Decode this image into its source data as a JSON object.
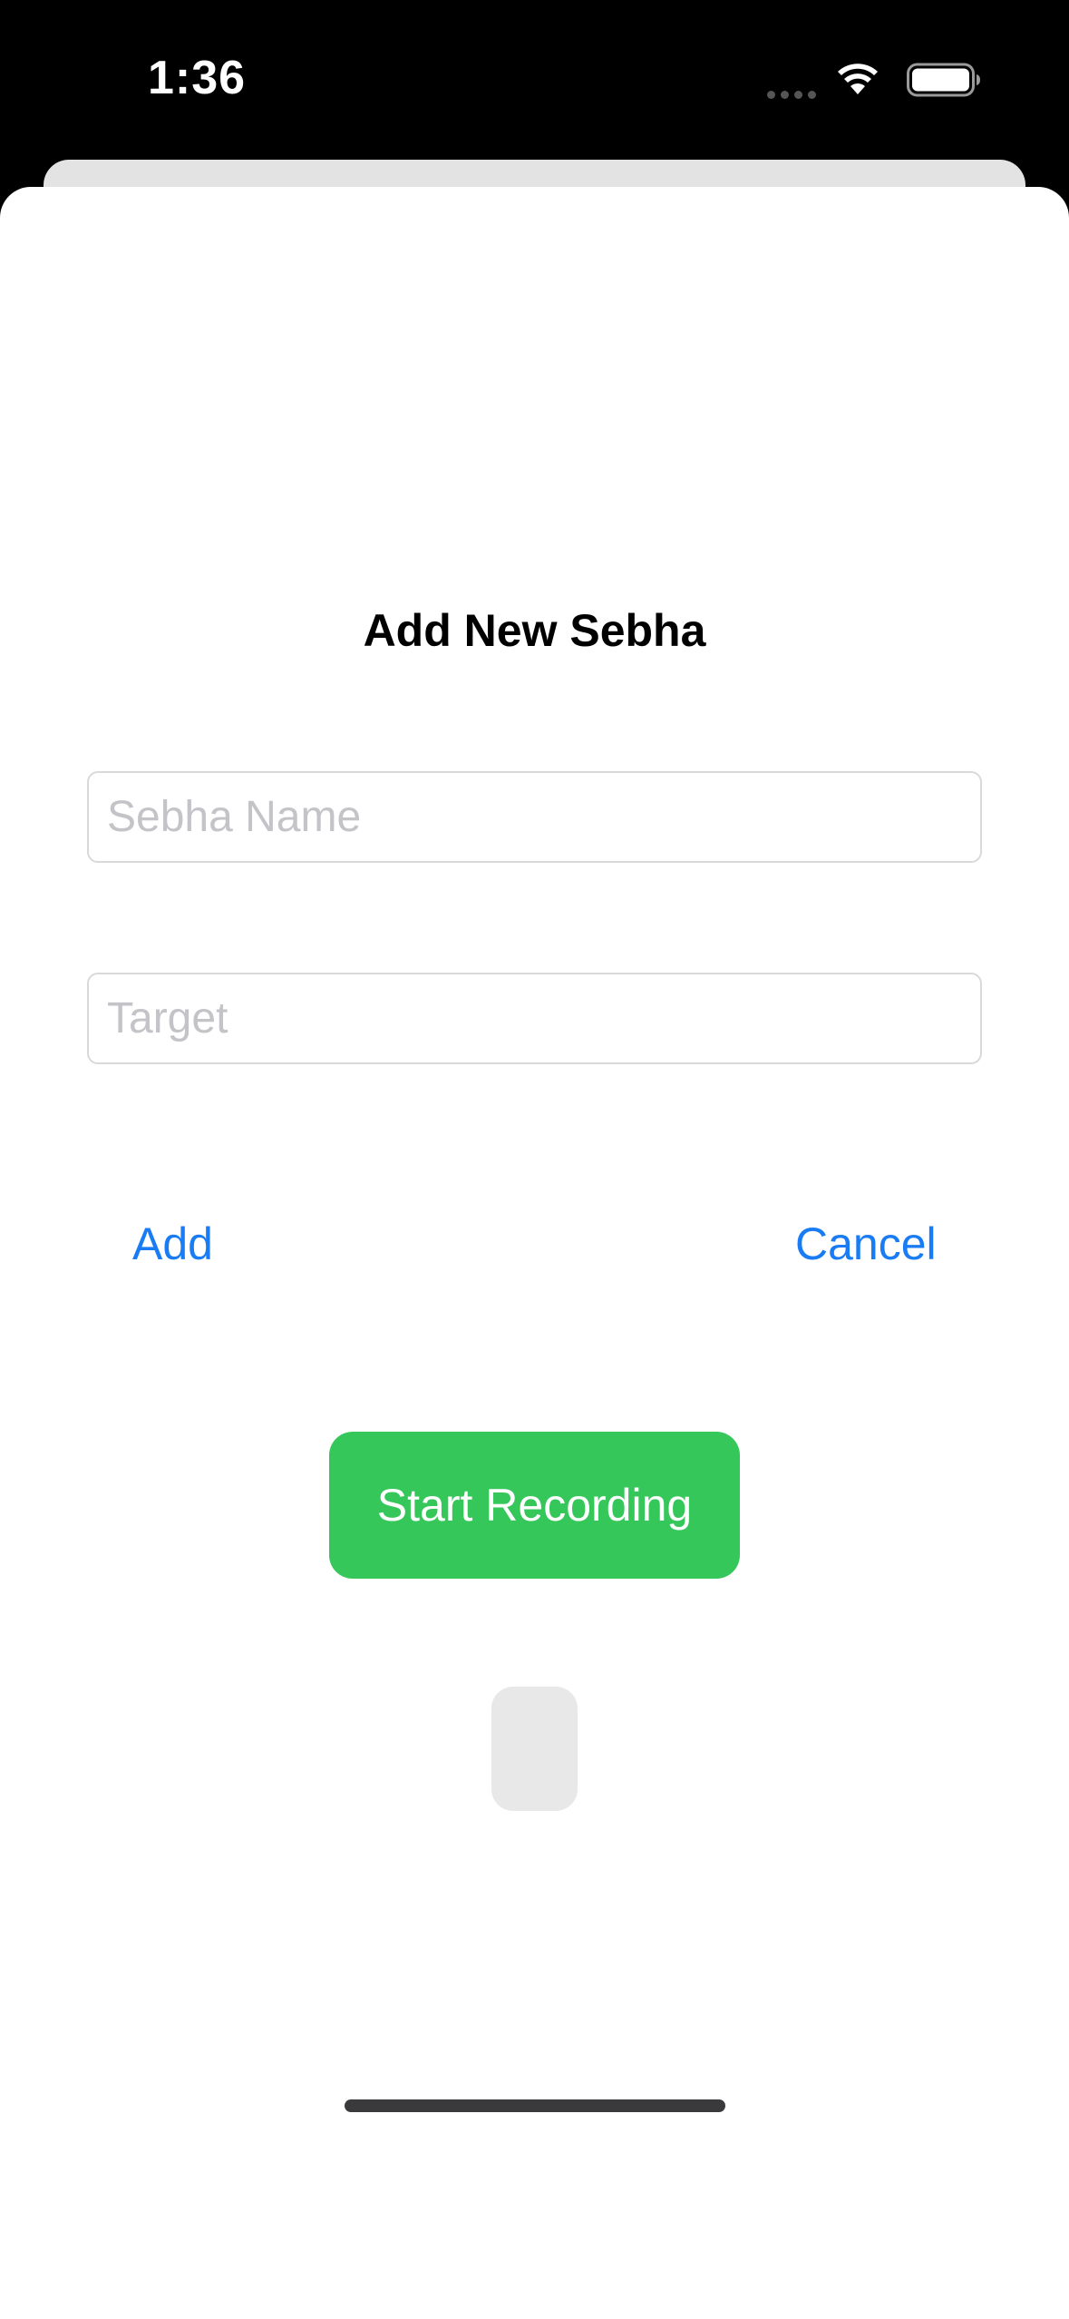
{
  "status_bar": {
    "time": "1:36",
    "icons": [
      "signal-dots-icon",
      "wifi-icon",
      "battery-icon"
    ]
  },
  "sheet": {
    "title": "Add New Sebha",
    "name_field": {
      "placeholder": "Sebha Name",
      "value": ""
    },
    "target_field": {
      "placeholder": "Target",
      "value": ""
    },
    "add_label": "Add",
    "cancel_label": "Cancel",
    "record_label": "Start Recording"
  },
  "colors": {
    "accent": "#1a7cf5",
    "record_button": "#35c759",
    "status_bar_bg": "#000000",
    "sheet_bg": "#ffffff"
  }
}
